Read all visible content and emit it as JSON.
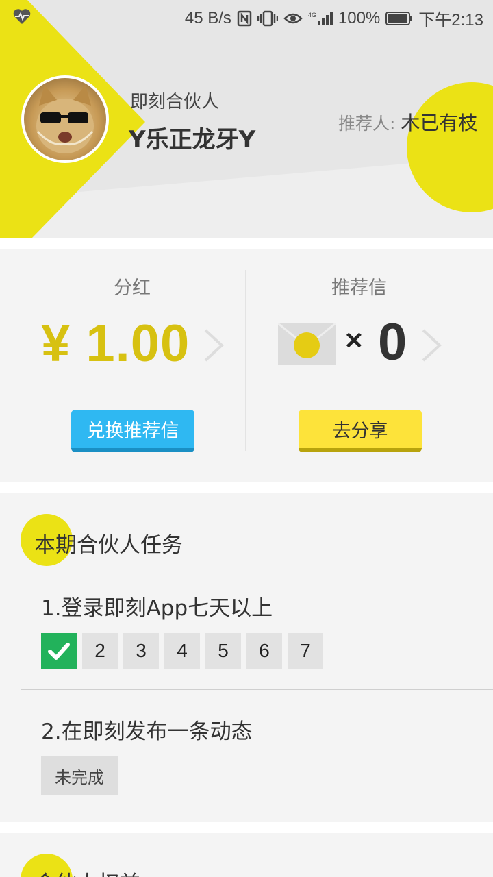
{
  "status_bar": {
    "network_speed": "45 B/s",
    "battery": "100%",
    "time": "下午2:13",
    "icons": [
      "heart-pulse-icon",
      "nfc-icon",
      "vibrate-icon",
      "eye-icon",
      "signal-4g-icon",
      "battery-icon"
    ]
  },
  "profile": {
    "role": "即刻合伙人",
    "nickname": "Y乐正龙牙Y",
    "referrer_label": "推荐人:",
    "referrer_name": "木已有枝"
  },
  "dividend": {
    "title": "分红",
    "amount": "¥ 1.00",
    "button": "兑换推荐信"
  },
  "letters": {
    "title": "推荐信",
    "times": "×",
    "count": "0",
    "button": "去分享"
  },
  "tasks": {
    "section_title": "本期合伙人任务",
    "task1": {
      "title": "1.登录即刻App七天以上",
      "days": [
        "2",
        "3",
        "4",
        "5",
        "6",
        "7"
      ],
      "completed_days": 1
    },
    "task2": {
      "title": "2.在即刻发布一条动态",
      "status": "未完成"
    }
  },
  "next_section": {
    "title": "合伙人权益"
  },
  "colors": {
    "accent_yellow": "#ebe215",
    "amount_yellow": "#d7c111",
    "blue_button": "#2fb8f2",
    "yellow_button": "#fde33a",
    "check_green": "#22b25b"
  }
}
